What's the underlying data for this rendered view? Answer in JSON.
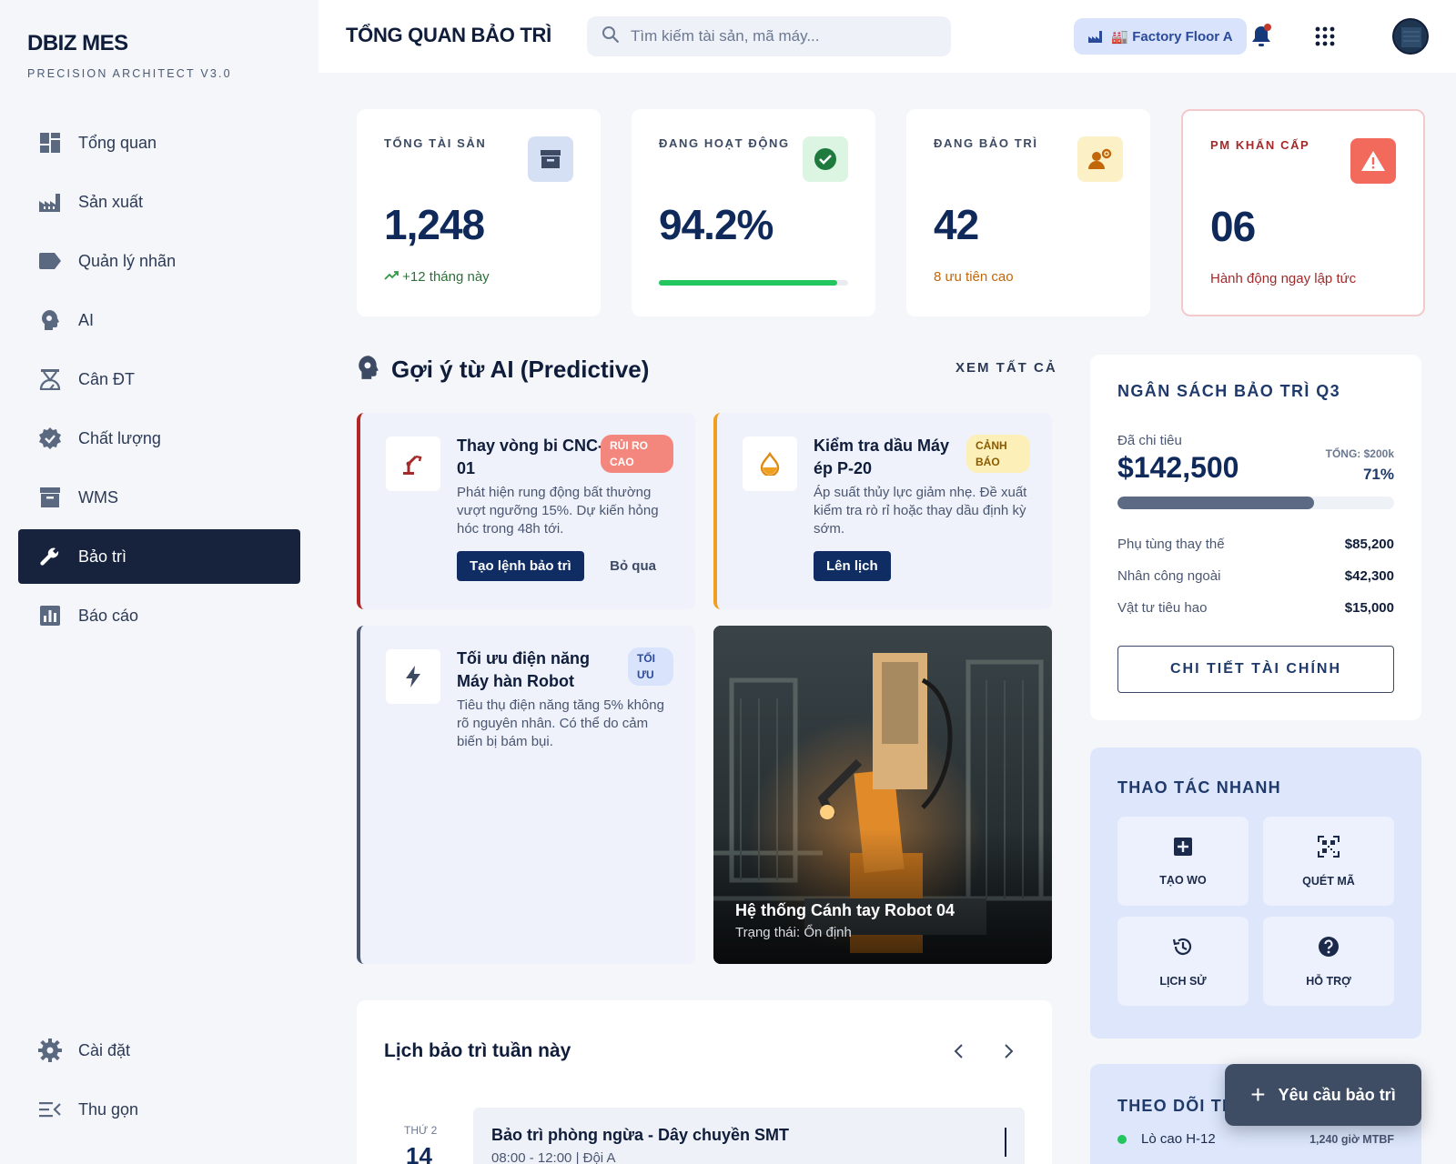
{
  "brand": {
    "title": "DBIZ MES",
    "subtitle": "PRECISION ARCHITECT V3.0"
  },
  "sidebar": {
    "items": [
      {
        "label": "Tổng quan",
        "icon": "dashboard-icon"
      },
      {
        "label": "Sản xuất",
        "icon": "factory-icon"
      },
      {
        "label": "Quản lý nhãn",
        "icon": "label-icon"
      },
      {
        "label": "AI",
        "icon": "ai-head-icon"
      },
      {
        "label": "Cân ĐT",
        "icon": "scale-icon"
      },
      {
        "label": "Chất lượng",
        "icon": "verified-icon"
      },
      {
        "label": "WMS",
        "icon": "inventory-icon"
      },
      {
        "label": "Bảo trì",
        "icon": "wrench-icon",
        "active": true
      },
      {
        "label": "Báo cáo",
        "icon": "report-icon"
      }
    ],
    "bottom": [
      {
        "label": "Cài đặt",
        "icon": "gear-icon"
      },
      {
        "label": "Thu gọn",
        "icon": "collapse-icon"
      }
    ]
  },
  "header": {
    "title": "TỔNG QUAN BẢO TRÌ",
    "search_placeholder": "Tìm kiếm tài sản, mã máy...",
    "factory": "🏭 Factory Floor A"
  },
  "kpis": [
    {
      "label": "TỔNG TÀI SẢN",
      "value": "1,248",
      "foot": "+12 tháng này",
      "foot_color": "#2f6f3a",
      "icon": "archive-icon"
    },
    {
      "label": "ĐANG HOẠT ĐỘNG",
      "value": "94.2%",
      "progress": 0.942,
      "icon": "check-circle-icon"
    },
    {
      "label": "ĐANG BẢO TRÌ",
      "value": "42",
      "foot": "8 ưu tiên cao",
      "foot_color": "#c2660a",
      "icon": "engineer-icon"
    },
    {
      "label": "PM KHẨN CẤP",
      "value": "06",
      "foot": "Hành động ngay lập tức",
      "foot_color": "#a32a2a",
      "icon": "warning-icon"
    }
  ],
  "ai": {
    "title": "Gợi ý từ AI (Predictive)",
    "see_all": "XEM TẤT CẢ",
    "cards": [
      {
        "title": "Thay vòng bi CNC-01",
        "tag": "RỦI RO CAO",
        "desc": "Phát hiện rung động bất thường vượt ngưỡng 15%. Dự kiến hỏng hóc trong 48h tới.",
        "primary": "Tạo lệnh bảo trì",
        "secondary": "Bỏ qua",
        "icon": "robot-arm-icon"
      },
      {
        "title": "Kiểm tra dầu Máy ép P-20",
        "tag": "CẢNH BÁO",
        "desc": "Áp suất thủy lực giảm nhẹ. Đề xuất kiểm tra rò rỉ hoặc thay dầu định kỳ sớm.",
        "primary": "Lên lịch",
        "icon": "oil-drop-icon"
      },
      {
        "title": "Tối ưu điện năng Máy hàn Robot",
        "tag": "TỐI ƯU",
        "desc": "Tiêu thụ điện năng tăng 5% không rõ nguyên nhân. Có thể do cảm biến bị bám bụi.",
        "icon": "bolt-icon"
      }
    ],
    "image": {
      "title": "Hệ thống Cánh tay Robot 04",
      "status": "Trạng thái: Ổn định"
    }
  },
  "schedule": {
    "title": "Lịch bảo trì tuần này",
    "day": "THỨ 2",
    "date": "14",
    "item_title": "Bảo trì phòng ngừa - Dây chuyền SMT",
    "item_sub": "08:00 - 12:00 | Đội A"
  },
  "budget": {
    "title": "NGÂN SÁCH BẢO TRÌ Q3",
    "spent_label": "Đã chi tiêu",
    "spent": "$142,500",
    "total": "TỔNG: $200k",
    "pct": "71%",
    "fraction": 0.71,
    "rows": [
      {
        "k": "Phụ tùng thay thế",
        "v": "$85,200"
      },
      {
        "k": "Nhân công ngoài",
        "v": "$42,300"
      },
      {
        "k": "Vật tư tiêu hao",
        "v": "$15,000"
      }
    ],
    "button": "CHI TIẾT TÀI CHÍNH"
  },
  "quick": {
    "title": "THAO TÁC NHANH",
    "actions": [
      {
        "label": "TẠO WO",
        "icon": "plus-box-icon"
      },
      {
        "label": "QUÉT MÃ",
        "icon": "qr-scan-icon"
      },
      {
        "label": "LỊCH SỬ",
        "icon": "history-icon"
      },
      {
        "label": "HỖ TRỢ",
        "icon": "help-icon"
      }
    ]
  },
  "tracking": {
    "title": "THEO DÕI TR",
    "row_name": "Lò cao H-12",
    "row_value": "1,240 giờ MTBF"
  },
  "fab": {
    "label": "Yêu cầu bảo trì"
  }
}
